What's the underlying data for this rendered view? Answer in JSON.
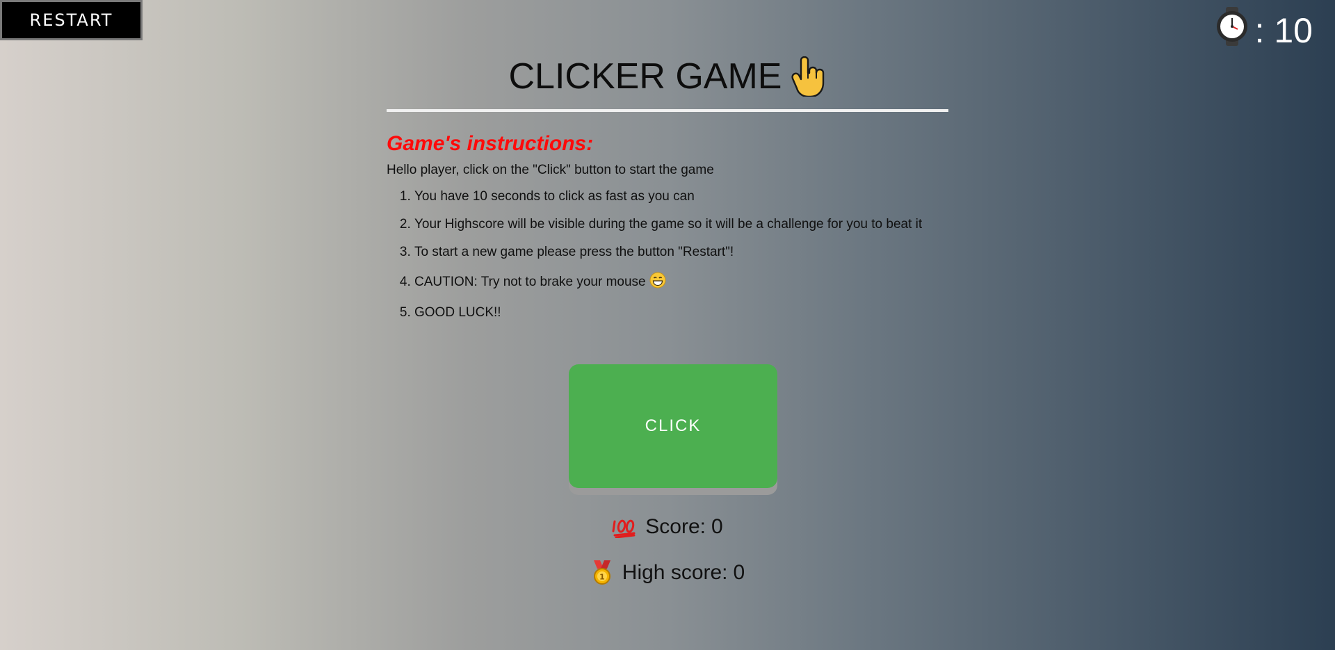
{
  "header": {
    "restart_label": "RESTART",
    "timer_icon": "stopwatch-icon",
    "timer_text": ": 10"
  },
  "title": {
    "text": "CLICKER GAME",
    "icon": "pointing-hand-icon"
  },
  "instructions": {
    "heading": "Game's instructions:",
    "intro": "Hello player, click on the \"Click\" button to start the game",
    "items": [
      "You have 10 seconds to click as fast as you can",
      "Your Highscore will be visible during the game so it will be a challenge for you to beat it",
      "To start a new game please press the button \"Restart\"!",
      "CAUTION: Try not to brake your mouse",
      "GOOD LUCK!!"
    ],
    "item4_icon": "grinning-face-icon"
  },
  "game": {
    "click_label": "CLICK",
    "score_label": "Score:",
    "score_value": "0",
    "score_icon": "hundred-points-icon",
    "highscore_label": "High score:",
    "highscore_value": "0",
    "highscore_icon": "medal-icon"
  },
  "colors": {
    "click_button": "#4caf50",
    "heading": "#ff0a0a",
    "restart_bg": "#000000"
  }
}
